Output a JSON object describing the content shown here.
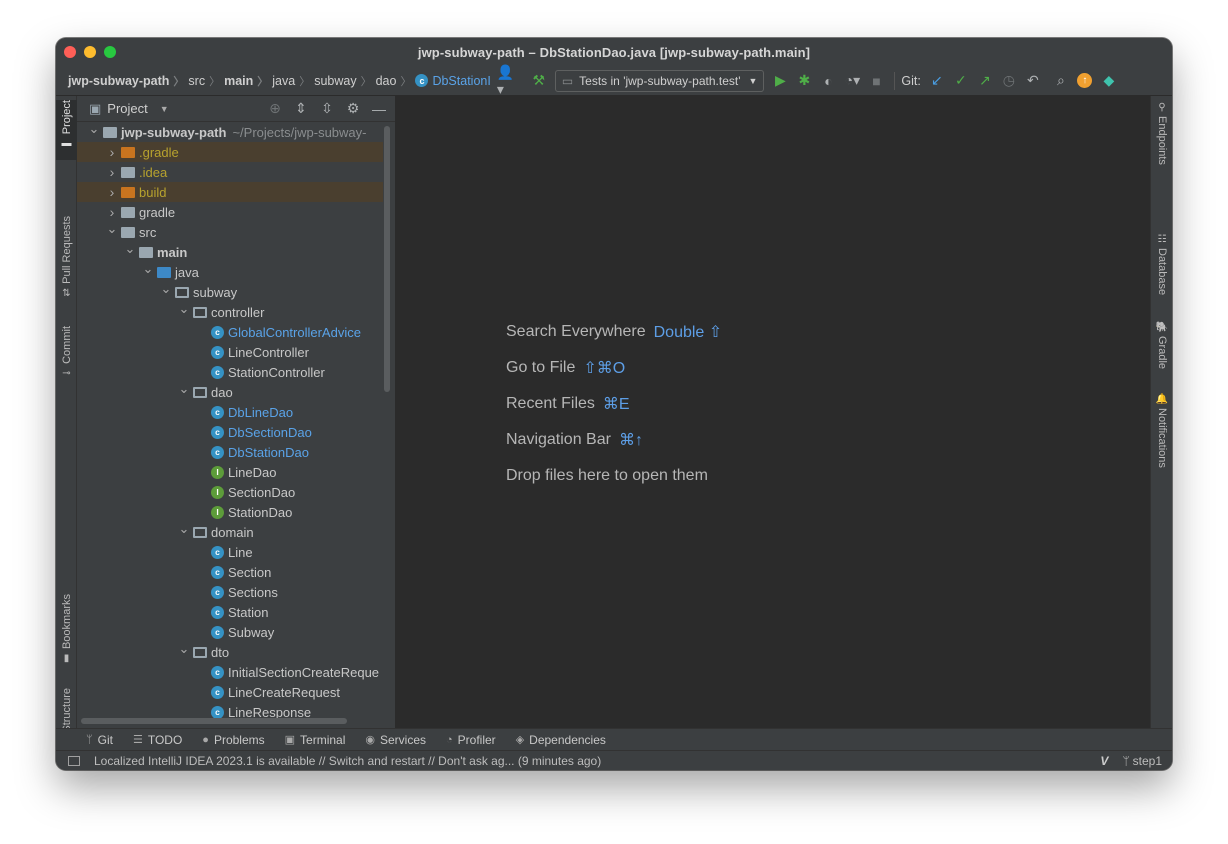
{
  "window": {
    "title": "jwp-subway-path – DbStationDao.java [jwp-subway-path.main]"
  },
  "breadcrumbs": [
    {
      "label": "jwp-subway-path",
      "bold": true
    },
    {
      "label": "src"
    },
    {
      "label": "main",
      "bold": true
    },
    {
      "label": "java"
    },
    {
      "label": "subway"
    },
    {
      "label": "dao"
    },
    {
      "label": "DbStationI",
      "class": true
    }
  ],
  "toolbar": {
    "run_config": "Tests in 'jwp-subway-path.test'",
    "git_label": "Git:"
  },
  "left_tabs": {
    "project": "Project",
    "pull_requests": "Pull Requests",
    "commit": "Commit",
    "bookmarks": "Bookmarks",
    "structure": "Structure"
  },
  "right_tabs": {
    "endpoints": "Endpoints",
    "database": "Database",
    "gradle": "Gradle",
    "notifications": "Notifications"
  },
  "project_panel": {
    "title": "Project",
    "tree": [
      {
        "depth": 0,
        "arrow": "down",
        "icon": "module-folder",
        "label": "jwp-subway-path",
        "bold": true,
        "hint": "~/Projects/jwp-subway-"
      },
      {
        "depth": 1,
        "arrow": "right",
        "icon": "folder-orange",
        "label": ".gradle",
        "color": "yellow",
        "highlight": true
      },
      {
        "depth": 1,
        "arrow": "right",
        "icon": "folder-gray",
        "label": ".idea",
        "color": "yellow"
      },
      {
        "depth": 1,
        "arrow": "right",
        "icon": "folder-orange",
        "label": "build",
        "color": "yellow",
        "highlight": true
      },
      {
        "depth": 1,
        "arrow": "right",
        "icon": "folder-gray",
        "label": "gradle"
      },
      {
        "depth": 1,
        "arrow": "down",
        "icon": "folder-gray",
        "label": "src"
      },
      {
        "depth": 2,
        "arrow": "down",
        "icon": "folder-gray",
        "label": "main",
        "bold": true
      },
      {
        "depth": 3,
        "arrow": "down",
        "icon": "folder-blue",
        "label": "java"
      },
      {
        "depth": 4,
        "arrow": "down",
        "icon": "package",
        "label": "subway"
      },
      {
        "depth": 5,
        "arrow": "down",
        "icon": "package",
        "label": "controller"
      },
      {
        "depth": 6,
        "icon": "class",
        "label": "GlobalControllerAdvice",
        "color": "blue"
      },
      {
        "depth": 6,
        "icon": "class",
        "label": "LineController"
      },
      {
        "depth": 6,
        "icon": "class",
        "label": "StationController"
      },
      {
        "depth": 5,
        "arrow": "down",
        "icon": "package",
        "label": "dao"
      },
      {
        "depth": 6,
        "icon": "class",
        "label": "DbLineDao",
        "color": "blue"
      },
      {
        "depth": 6,
        "icon": "class",
        "label": "DbSectionDao",
        "color": "blue"
      },
      {
        "depth": 6,
        "icon": "class",
        "label": "DbStationDao",
        "color": "blue"
      },
      {
        "depth": 6,
        "icon": "interface",
        "label": "LineDao"
      },
      {
        "depth": 6,
        "icon": "interface",
        "label": "SectionDao"
      },
      {
        "depth": 6,
        "icon": "interface",
        "label": "StationDao"
      },
      {
        "depth": 5,
        "arrow": "down",
        "icon": "package",
        "label": "domain"
      },
      {
        "depth": 6,
        "icon": "class",
        "label": "Line"
      },
      {
        "depth": 6,
        "icon": "class",
        "label": "Section"
      },
      {
        "depth": 6,
        "icon": "class",
        "label": "Sections"
      },
      {
        "depth": 6,
        "icon": "class",
        "label": "Station"
      },
      {
        "depth": 6,
        "icon": "class",
        "label": "Subway"
      },
      {
        "depth": 5,
        "arrow": "down",
        "icon": "package",
        "label": "dto"
      },
      {
        "depth": 6,
        "icon": "class",
        "label": "InitialSectionCreateReque"
      },
      {
        "depth": 6,
        "icon": "class",
        "label": "LineCreateRequest"
      },
      {
        "depth": 6,
        "icon": "class",
        "label": "LineResponse"
      }
    ]
  },
  "editor_hints": [
    {
      "text": "Search Everywhere",
      "key": "Double ⇧"
    },
    {
      "text": "Go to File",
      "key": "⇧⌘O"
    },
    {
      "text": "Recent Files",
      "key": "⌘E"
    },
    {
      "text": "Navigation Bar",
      "key": "⌘↑"
    },
    {
      "text": "Drop files here to open them",
      "key": ""
    }
  ],
  "bottom_tabs": [
    {
      "icon": "git-branch-icon",
      "glyph": "ᛘ",
      "label": "Git"
    },
    {
      "icon": "todo-icon",
      "glyph": "☰",
      "label": "TODO"
    },
    {
      "icon": "problems-icon",
      "glyph": "●",
      "label": "Problems"
    },
    {
      "icon": "terminal-icon",
      "glyph": "▣",
      "label": "Terminal"
    },
    {
      "icon": "services-icon",
      "glyph": "◉",
      "label": "Services"
    },
    {
      "icon": "profiler-icon",
      "glyph": "◔",
      "label": "Profiler"
    },
    {
      "icon": "dependencies-icon",
      "glyph": "◈",
      "label": "Dependencies"
    }
  ],
  "status": {
    "message": "Localized IntelliJ IDEA 2023.1 is available // Switch and restart // Don't ask ag... (9 minutes ago)",
    "branch": "step1"
  },
  "colors": {
    "accent_blue": "#5aa3e8",
    "run_green": "#4fae48",
    "ignored_yellow": "#b7a22e"
  }
}
